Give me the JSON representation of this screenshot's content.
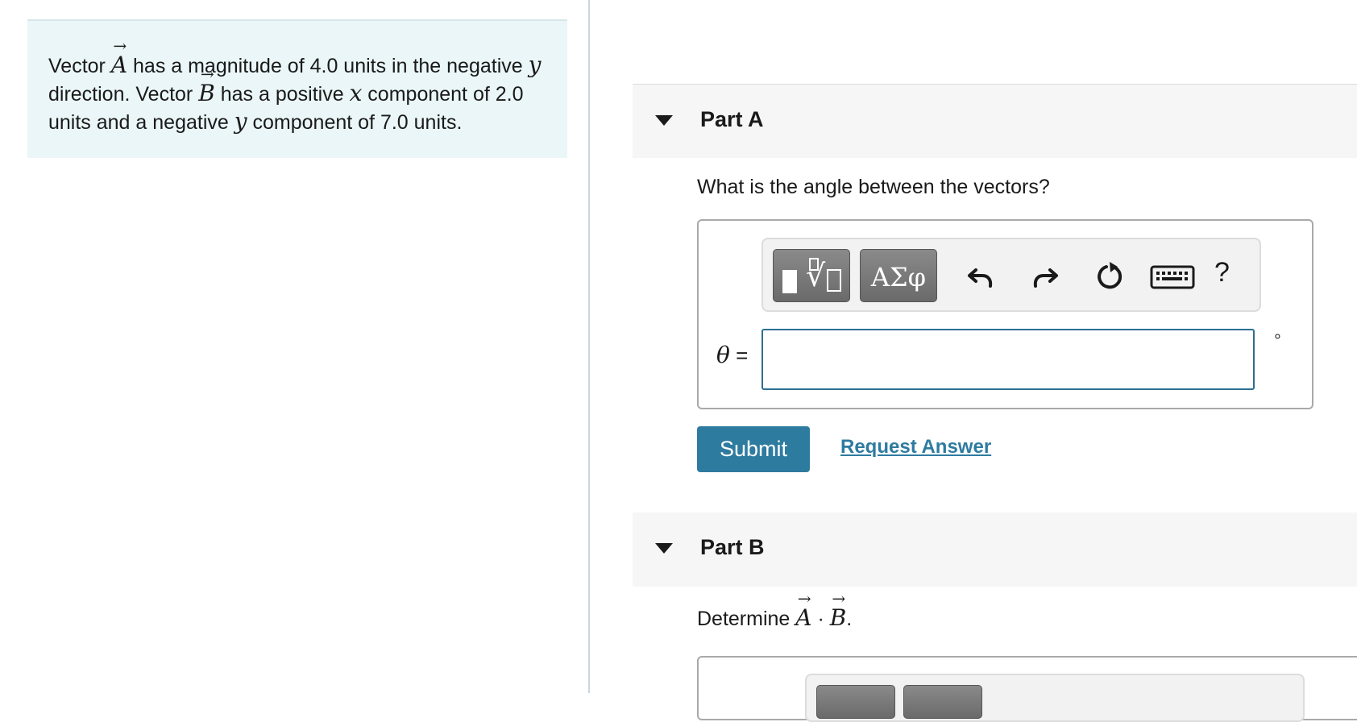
{
  "problem": {
    "t1": "Vector ",
    "vecA": "A",
    "t2": " has a magnitude of 4.0 units in the negative ",
    "y1": "y",
    "t3": " direction. Vector ",
    "vecB": "B",
    "t4": " has a positive ",
    "x1": "x",
    "t5": " component of 2.0 units and a negative ",
    "y2": "y",
    "t6": " component of 7.0 units."
  },
  "partA": {
    "title": "Part A",
    "question": "What is the angle between the vectors?",
    "toolbar": {
      "symbols_label": "ΑΣφ",
      "help_label": "?"
    },
    "variable": "θ",
    "equals": " =",
    "input_value": "",
    "unit": "°",
    "submit_label": "Submit",
    "request_answer_label": "Request Answer"
  },
  "partB": {
    "title": "Part B",
    "prefix": "Determine ",
    "vecA": "A",
    "dot": " · ",
    "vecB": "B",
    "suffix": "."
  },
  "colors": {
    "accent": "#2e7ba0",
    "problem_bg": "#eaf6f7",
    "header_bg": "#f6f6f6"
  }
}
